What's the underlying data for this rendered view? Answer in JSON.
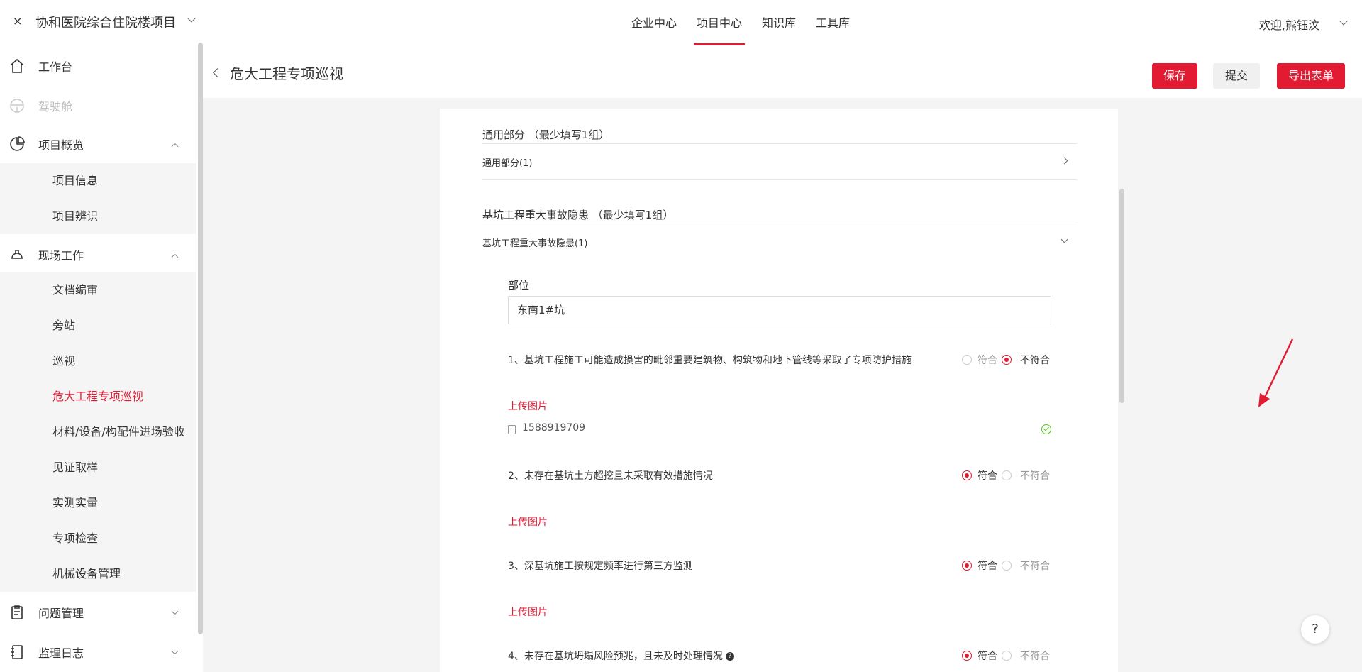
{
  "topbar": {
    "close_glyph": "×",
    "project_name": "协和医院综合住院楼项目",
    "nav": [
      "企业中心",
      "项目中心",
      "知识库",
      "工具库"
    ],
    "active_nav": 1,
    "welcome": "欢迎,熊钰汶"
  },
  "sidebar": {
    "workbench": "工作台",
    "cockpit": "驾驶舱",
    "overview": "项目概览",
    "overview_items": [
      "项目信息",
      "项目辨识"
    ],
    "field_work": "现场工作",
    "field_items": [
      "文档编审",
      "旁站",
      "巡视",
      "危大工程专项巡视",
      "材料/设备/构配件进场验收",
      "见证取样",
      "实测实量",
      "专项检查",
      "机械设备管理"
    ],
    "active_item": "危大工程专项巡视",
    "issues": "问题管理",
    "log": "监理日志"
  },
  "header": {
    "title": "危大工程专项巡视",
    "save": "保存",
    "submit": "提交",
    "export": "导出表单"
  },
  "form": {
    "section1_title": "通用部分 （最少填写1组）",
    "section1_group": "通用部分(1)",
    "section2_title": "基坑工程重大事故隐患 （最少填写1组）",
    "section2_group": "基坑工程重大事故隐患(1)",
    "location_label": "部位",
    "location_value": "东南1#坑",
    "pass_label": "符合",
    "fail_label": "不符合",
    "upload_label": "上传图片",
    "questions": [
      {
        "text": "1、基坑工程施工可能造成损害的毗邻重要建筑物、构筑物和地下管线等采取了专项防护措施",
        "selected": "不符合"
      },
      {
        "text": "2、未存在基坑土方超挖且未采取有效措施情况",
        "selected": "符合"
      },
      {
        "text": "3、深基坑施工按规定频率进行第三方监测",
        "selected": "符合"
      },
      {
        "text": "4、未存在基坑坍塌风险预兆，且未及时处理情况",
        "selected": "符合"
      }
    ],
    "file_name": "1588919709",
    "help_glyph": "?"
  },
  "fab": {
    "help": "?"
  },
  "colors": {
    "accent": "#e21a32",
    "success": "#52c41a"
  }
}
